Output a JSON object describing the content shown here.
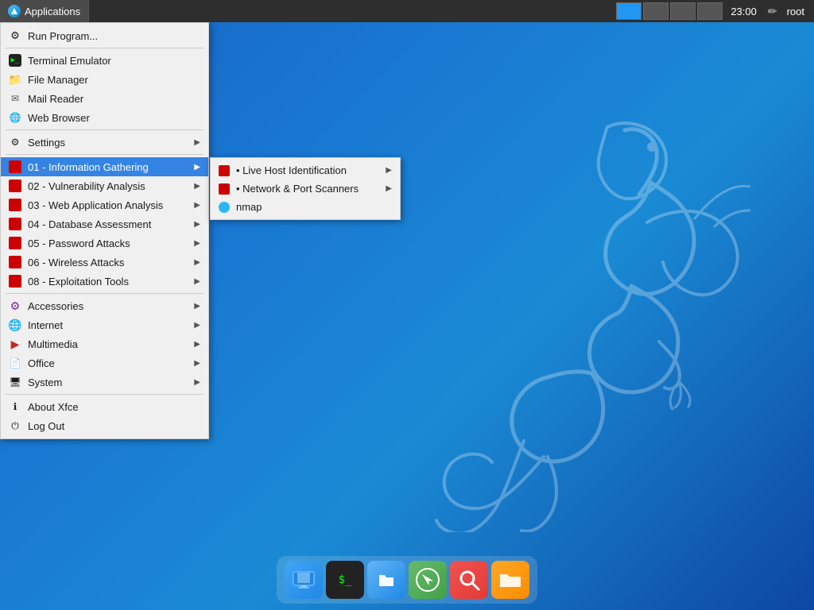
{
  "taskbar": {
    "applications_label": "Applications",
    "clock": "23:00",
    "username": "root",
    "workspaces": [
      {
        "id": 1,
        "active": true
      },
      {
        "id": 2,
        "active": false
      },
      {
        "id": 3,
        "active": false
      },
      {
        "id": 4,
        "active": false
      }
    ]
  },
  "menu": {
    "items": [
      {
        "id": "run-program",
        "label": "Run Program...",
        "icon": "gear",
        "hasSubmenu": false
      },
      {
        "id": "separator1",
        "type": "separator"
      },
      {
        "id": "terminal",
        "label": "Terminal Emulator",
        "icon": "terminal",
        "hasSubmenu": false
      },
      {
        "id": "filemanager",
        "label": "File Manager",
        "icon": "files",
        "hasSubmenu": false
      },
      {
        "id": "mailreader",
        "label": "Mail Reader",
        "icon": "mail",
        "hasSubmenu": false
      },
      {
        "id": "webbrowser",
        "label": "Web Browser",
        "icon": "web",
        "hasSubmenu": false
      },
      {
        "id": "separator2",
        "type": "separator"
      },
      {
        "id": "settings",
        "label": "Settings",
        "icon": "settings",
        "hasSubmenu": true
      },
      {
        "id": "separator3",
        "type": "separator"
      },
      {
        "id": "info-gathering",
        "label": "01 - Information Gathering",
        "icon": "red",
        "hasSubmenu": true,
        "active": true
      },
      {
        "id": "vuln-analysis",
        "label": "02 - Vulnerability Analysis",
        "icon": "red",
        "hasSubmenu": true
      },
      {
        "id": "web-app",
        "label": "03 - Web Application Analysis",
        "icon": "red",
        "hasSubmenu": true
      },
      {
        "id": "db-assess",
        "label": "04 - Database Assessment",
        "icon": "red",
        "hasSubmenu": true
      },
      {
        "id": "password",
        "label": "05 - Password Attacks",
        "icon": "red",
        "hasSubmenu": true
      },
      {
        "id": "wireless",
        "label": "06 - Wireless Attacks",
        "icon": "red",
        "hasSubmenu": true
      },
      {
        "id": "exploit",
        "label": "08 - Exploitation Tools",
        "icon": "red",
        "hasSubmenu": true
      },
      {
        "id": "separator4",
        "type": "separator"
      },
      {
        "id": "accessories",
        "label": "Accessories",
        "icon": "accessories",
        "hasSubmenu": true
      },
      {
        "id": "internet",
        "label": "Internet",
        "icon": "internet",
        "hasSubmenu": true
      },
      {
        "id": "multimedia",
        "label": "Multimedia",
        "icon": "multimedia",
        "hasSubmenu": true
      },
      {
        "id": "office",
        "label": "Office",
        "icon": "office",
        "hasSubmenu": true
      },
      {
        "id": "system",
        "label": "System",
        "icon": "system",
        "hasSubmenu": true
      },
      {
        "id": "separator5",
        "type": "separator"
      },
      {
        "id": "about-xfce",
        "label": "About Xfce",
        "icon": "info",
        "hasSubmenu": false
      },
      {
        "id": "logout",
        "label": "Log Out",
        "icon": "logout",
        "hasSubmenu": false
      }
    ]
  },
  "submenu": {
    "items": [
      {
        "id": "live-host",
        "label": "• Live Host Identification",
        "hasSubmenu": true
      },
      {
        "id": "network-port",
        "label": "• Network & Port Scanners",
        "hasSubmenu": true
      },
      {
        "id": "nmap",
        "label": "nmap",
        "hasSubmenu": false,
        "icon": "eye"
      }
    ]
  },
  "dock": {
    "items": [
      {
        "id": "desktop-preview",
        "icon": "desktop",
        "label": "Desktop"
      },
      {
        "id": "terminal-dock",
        "icon": "terminal",
        "label": "Terminal"
      },
      {
        "id": "files-dock",
        "icon": "files",
        "label": "Files"
      },
      {
        "id": "browser-dock",
        "icon": "browser",
        "label": "Browser"
      },
      {
        "id": "search-dock",
        "icon": "search",
        "label": "Search"
      },
      {
        "id": "folder-dock",
        "icon": "folder",
        "label": "Folder"
      }
    ]
  }
}
